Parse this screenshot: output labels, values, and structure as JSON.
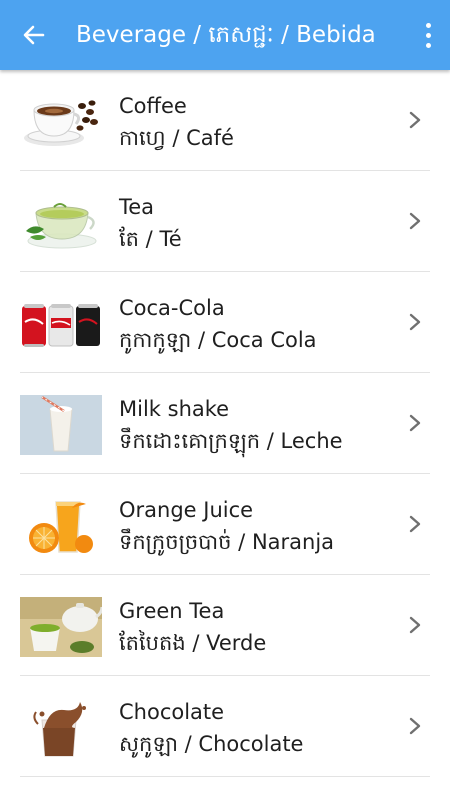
{
  "header": {
    "title": "Beverage / ភេសជ្ជៈ / Bebida",
    "back_icon": "arrow-left-icon",
    "menu_icon": "more-vert-icon",
    "bar_color": "#4da3f0"
  },
  "items": [
    {
      "name": "Coffee",
      "khmer": "កាហ្វេ",
      "spanish": "Café",
      "icon": "coffee-cup-icon"
    },
    {
      "name": "Tea",
      "khmer": "តែ",
      "spanish": "Té",
      "icon": "tea-cup-icon"
    },
    {
      "name": "Coca-Cola",
      "khmer": "កូកាកូឡា",
      "spanish": "Coca Cola",
      "icon": "cola-cans-icon"
    },
    {
      "name": "Milk shake",
      "khmer": "ទឹកដោះគោក្រឡុក",
      "spanish": "Leche",
      "icon": "milkshake-glass-icon"
    },
    {
      "name": "Orange Juice",
      "khmer": "ទឹកក្រូចច្របាច់",
      "spanish": "Naranja",
      "icon": "orange-juice-icon"
    },
    {
      "name": "Green Tea",
      "khmer": "តែបៃតង",
      "spanish": "Verde",
      "icon": "green-tea-icon"
    },
    {
      "name": "Chocolate",
      "khmer": "សូកូឡា",
      "spanish": "Chocolate",
      "icon": "chocolate-splash-icon"
    }
  ],
  "separator": "  /  "
}
